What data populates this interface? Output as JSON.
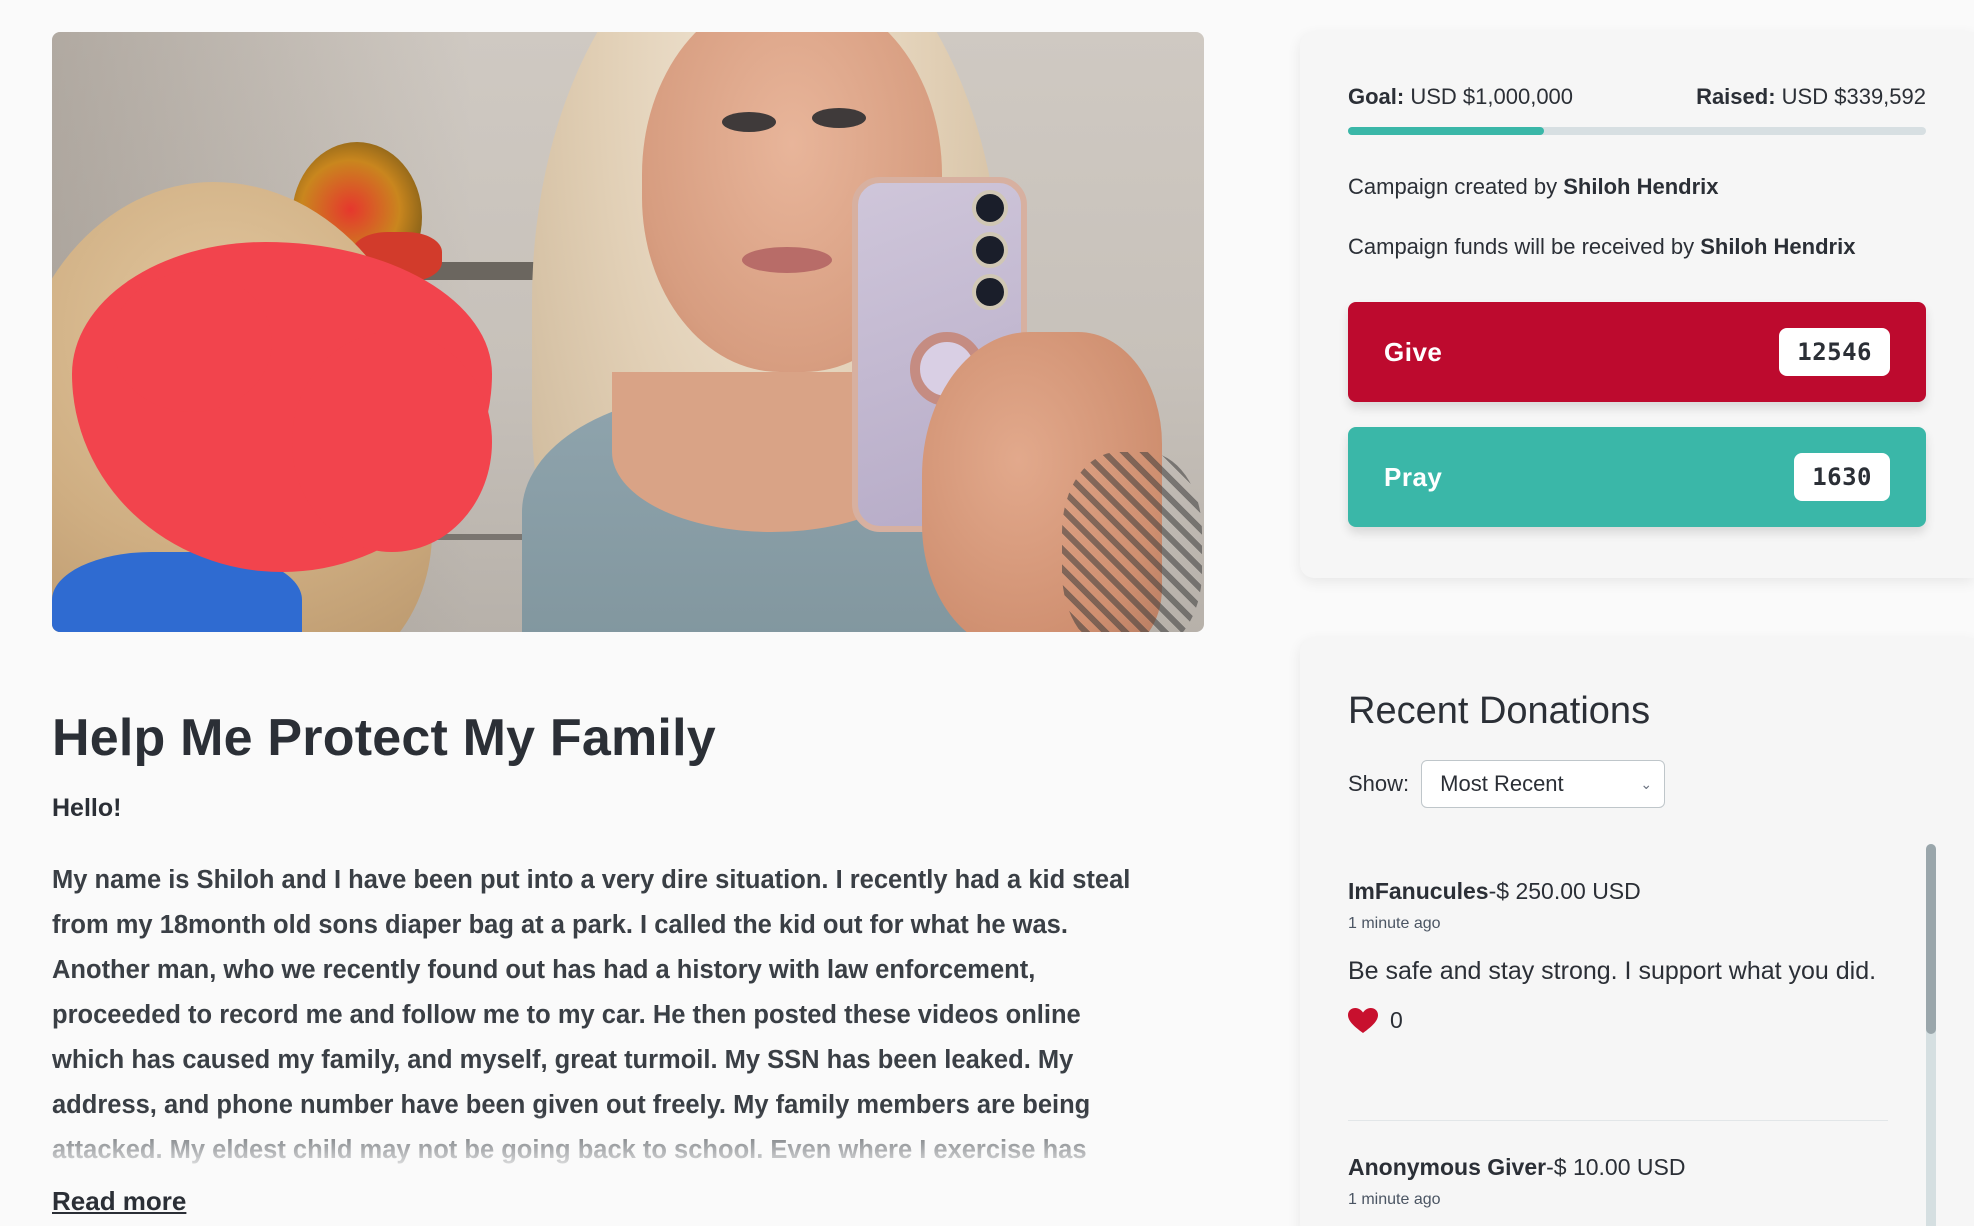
{
  "campaign": {
    "title": "Help Me Protect My Family",
    "greeting": "Hello!",
    "story": "My name is Shiloh and I have been put into a very dire situation. I recently had a kid steal from my 18month old sons diaper bag at a park. I called the kid out for what he was. Another man, who we recently found out has had a history with law enforcement, proceeded to record me and follow me to my car. He then posted these videos online which has caused my family, and myself, great turmoil. My SSN has been leaked. My address, and phone number have been given out freely. My family members are being attacked. My eldest child may not be going back to school. Even where I exercise has",
    "read_more": "Read more"
  },
  "funding": {
    "goal_label": "Goal:",
    "goal_value": "USD $1,000,000",
    "raised_label": "Raised:",
    "raised_value": "USD $339,592",
    "progress_fraction": 0.339592,
    "creator_prefix": "Campaign created by",
    "creator_name": "Shiloh Hendrix",
    "receiver_prefix": "Campaign funds will be received by",
    "receiver_name": "Shiloh Hendrix"
  },
  "actions": {
    "give_label": "Give",
    "give_count": "12546",
    "pray_label": "Pray",
    "pray_count": "1630"
  },
  "recent": {
    "title": "Recent Donations",
    "show_label": "Show:",
    "sort_selected": "Most Recent",
    "donations": [
      {
        "name": "ImFanucules",
        "amount": "-$ 250.00 USD",
        "time": "1 minute ago",
        "message": "Be safe and stay strong. I support what you did.",
        "likes": "0"
      },
      {
        "name": "Anonymous Giver",
        "amount": "-$ 10.00 USD",
        "time": "1 minute ago"
      }
    ]
  },
  "colors": {
    "give": "#bd0a2e",
    "pray": "#3ab7a8",
    "progress": "#3ab7a8",
    "heart": "#c8102e"
  },
  "icons": {
    "heart": "heart-icon",
    "chevron": "chevron-down-icon"
  }
}
